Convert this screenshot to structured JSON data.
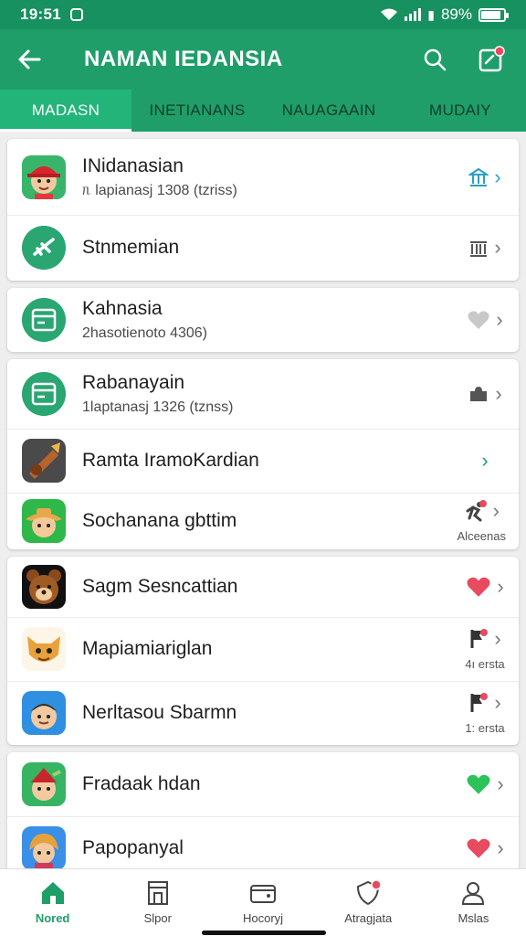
{
  "status_bar": {
    "time": "19:51",
    "battery": "89%"
  },
  "app_bar": {
    "title": "NAMAN IEDANSIA"
  },
  "tabs": [
    {
      "label": "MADASN",
      "active": true
    },
    {
      "label": "INETIANANS",
      "active": false
    },
    {
      "label": "NAUAGAAIN",
      "active": false
    },
    {
      "label": "MUDAIY",
      "active": false
    }
  ],
  "cards": [
    {
      "rows": [
        {
          "title": "INidanasian",
          "subtitle": "ᥰ lapianasj 1308 (tzriss)",
          "avatar": "character-red-cap",
          "trailing_icon": "bank-icon",
          "trailing_caption": ""
        },
        {
          "title": "Stnmemian",
          "subtitle": "",
          "avatar": "airplane",
          "trailing_icon": "columns-icon",
          "trailing_caption": ""
        }
      ]
    },
    {
      "rows": [
        {
          "title": "Kahnasia",
          "subtitle": "2hasotienoto 4306)",
          "avatar": "book",
          "trailing_icon": "heart-gray-icon",
          "trailing_caption": ""
        }
      ]
    },
    {
      "rows": [
        {
          "title": "Rabanayain",
          "subtitle": "1laptanasj 1326 (tznss)",
          "avatar": "book",
          "trailing_icon": "puzzle-icon",
          "trailing_caption": ""
        },
        {
          "title": "Ramta IramoKardian",
          "subtitle": "",
          "avatar": "instrument",
          "trailing_icon": "",
          "trailing_caption": ""
        },
        {
          "title": "Sochanana gbttim",
          "subtitle": "",
          "avatar": "cowboy",
          "trailing_icon": "runner-icon",
          "trailing_caption": "Alceenas"
        }
      ]
    },
    {
      "rows": [
        {
          "title": "Sagm Sesncattian",
          "subtitle": "",
          "avatar": "bear",
          "trailing_icon": "heart-red-icon",
          "trailing_caption": ""
        },
        {
          "title": "Mapiamiariglan",
          "subtitle": "",
          "avatar": "mask",
          "trailing_icon": "flag-icon",
          "trailing_caption": "4ı ersta"
        },
        {
          "title": "Nerltasou Sbarmn",
          "subtitle": "",
          "avatar": "boy",
          "trailing_icon": "flag-icon",
          "trailing_caption": "1: ersta"
        }
      ]
    },
    {
      "rows": [
        {
          "title": "Fradaak hdan",
          "subtitle": "",
          "avatar": "elf",
          "trailing_icon": "heart-green-icon",
          "trailing_caption": ""
        },
        {
          "title": "Papopanyal",
          "subtitle": "",
          "avatar": "girl",
          "trailing_icon": "heart-red-icon",
          "trailing_caption": ""
        }
      ]
    }
  ],
  "bottom_nav": [
    {
      "label": "Nored",
      "icon": "home-icon",
      "active": true
    },
    {
      "label": "Slpor",
      "icon": "store-icon",
      "active": false
    },
    {
      "label": "Hocoryj",
      "icon": "wallet-icon",
      "active": false
    },
    {
      "label": "Atragjata",
      "icon": "shield-icon",
      "active": false
    },
    {
      "label": "Mslas",
      "icon": "person-icon",
      "active": false
    }
  ],
  "colors": {
    "primary": "#1f9e6a",
    "status_bar": "#17915f",
    "heart_red": "#e84a5f",
    "heart_green": "#2ec25a"
  }
}
